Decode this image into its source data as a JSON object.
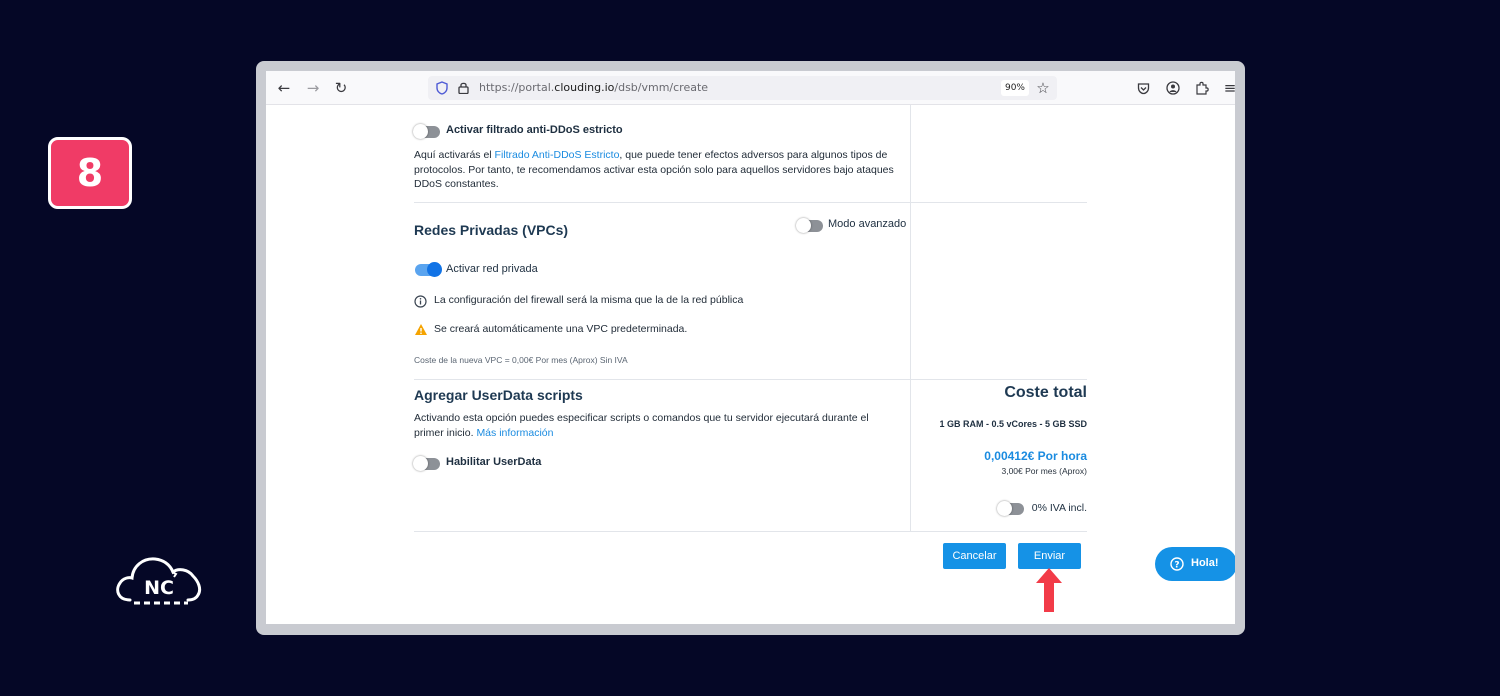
{
  "step": {
    "number": "8"
  },
  "logo": {
    "text": "NC"
  },
  "browser": {
    "url_prefix": "https://portal.",
    "url_domain": "clouding.io",
    "url_path": "/dsb/vmm/create",
    "zoom": "90%"
  },
  "ddos": {
    "toggle_label": "Activar filtrado anti-DDoS estricto",
    "desc_start": "Aquí activarás el ",
    "desc_link": "Filtrado Anti-DDoS Estricto",
    "desc_end": ", que puede tener efectos adversos para algunos tipos de",
    "desc_line2": "protocolos. Por tanto, te recomendamos activar esta opción solo para aquellos servidores bajo ataques",
    "desc_line3": "DDoS constantes."
  },
  "vpc": {
    "title": "Redes Privadas (VPCs)",
    "advanced_label": "Modo avanzado",
    "private_network_label": "Activar red privada",
    "firewall_info": "La configuración del firewall será la misma que la de la red pública",
    "warning": "Se creará automáticamente una VPC predeterminada.",
    "cost_note": "Coste de la nueva VPC = 0,00€ Por mes (Aprox) Sin IVA"
  },
  "userdata": {
    "title": "Agregar UserData scripts",
    "desc_line1": "Activando esta opción puedes especificar scripts o comandos que tu servidor ejecutará durante el",
    "desc_line2_start": "primer inicio. ",
    "desc_link": "Más información",
    "toggle_label": "Habilitar UserData"
  },
  "summary": {
    "title": "Coste total",
    "specs": "1 GB RAM - 0.5 vCores - 5 GB SSD",
    "hourly": "0,00412€ Por hora",
    "monthly": "3,00€ Por mes (Aprox)",
    "vat_label": "0% IVA incl."
  },
  "actions": {
    "cancel": "Cancelar",
    "submit": "Enviar"
  },
  "chat": {
    "label": "Hola!"
  },
  "colors": {
    "accent": "#1592e6",
    "badge": "#f03b66",
    "arrow": "#f23b48",
    "background": "#050726"
  }
}
